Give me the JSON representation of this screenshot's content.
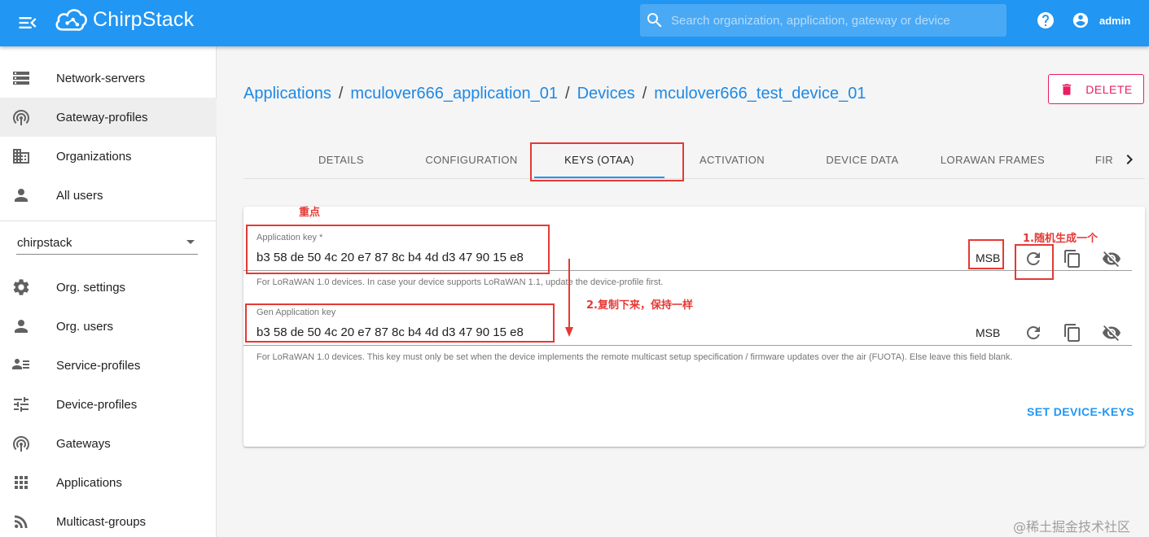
{
  "header": {
    "brand": "ChirpStack",
    "search_placeholder": "Search organization, application, gateway or device",
    "username": "admin"
  },
  "sidebar": {
    "admin_items": [
      {
        "label": "Network-servers",
        "icon": "server-icon"
      },
      {
        "label": "Gateway-profiles",
        "icon": "gateway-profile-icon"
      },
      {
        "label": "Organizations",
        "icon": "domain-icon"
      },
      {
        "label": "All users",
        "icon": "user-icon"
      }
    ],
    "organization": "chirpstack",
    "org_items": [
      {
        "label": "Org. settings",
        "icon": "gear-icon"
      },
      {
        "label": "Org. users",
        "icon": "user-icon"
      },
      {
        "label": "Service-profiles",
        "icon": "service-profile-icon"
      },
      {
        "label": "Device-profiles",
        "icon": "tune-icon"
      },
      {
        "label": "Gateways",
        "icon": "gateway-icon"
      },
      {
        "label": "Applications",
        "icon": "apps-icon"
      },
      {
        "label": "Multicast-groups",
        "icon": "rss-icon"
      }
    ]
  },
  "breadcrumb": {
    "applications": "Applications",
    "application": "mculover666_application_01",
    "devices": "Devices",
    "device": "mculover666_test_device_01",
    "separator": "/"
  },
  "delete_label": "DELETE",
  "tabs": [
    "DETAILS",
    "CONFIGURATION",
    "KEYS (OTAA)",
    "ACTIVATION",
    "DEVICE DATA",
    "LORAWAN FRAMES",
    "FIR"
  ],
  "active_tab": "KEYS (OTAA)",
  "keys": {
    "app_key": {
      "label": "Application key *",
      "value": "b3 58 de 50 4c 20 e7 87 8c b4 4d d3 47 90 15 e8",
      "byte_order": "MSB",
      "helper": "For LoRaWAN 1.0 devices. In case your device supports LoRaWAN 1.1, update the device-profile first."
    },
    "gen_app_key": {
      "label": "Gen Application key",
      "value": "b3 58 de 50 4c 20 e7 87 8c b4 4d d3 47 90 15 e8",
      "byte_order": "MSB",
      "helper": "For LoRaWAN 1.0 devices. This key must only be set when the device implements the remote multicast setup specification / firmware updates over the air (FUOTA). Else leave this field blank."
    },
    "submit_label": "SET DEVICE-KEYS"
  },
  "annotations": {
    "important": "重点",
    "step1": "1.随机生成一个",
    "step2": "2.复制下来，保持一样"
  },
  "watermark": "@稀土掘金技术社区",
  "colors": {
    "primary": "#2196f3",
    "delete": "#e91e63",
    "annotation": "#e53935"
  }
}
